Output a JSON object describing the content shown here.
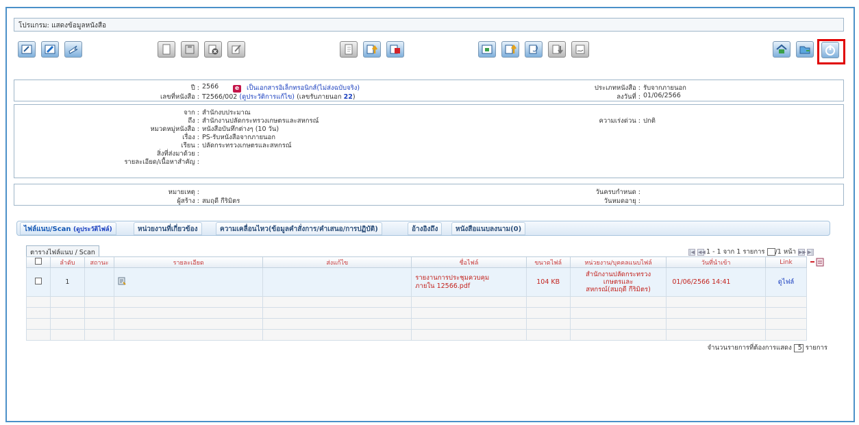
{
  "program_title": "โปรแกรม: แสดงข้อมูลหนังสือ",
  "toolbar": {
    "groups": [
      [
        "edit-icon",
        "pencil-icon",
        "forward-icon"
      ],
      [
        "document-icon",
        "save-icon",
        "delete-icon",
        "copy-icon"
      ],
      [
        "new-file-icon",
        "upload-icon",
        "red-stop-icon"
      ],
      [
        "download-icon",
        "import-icon",
        "attach-icon",
        "arrow-down-icon",
        "sign-icon"
      ],
      [
        "home-icon",
        "folder-icon",
        "power-icon"
      ]
    ]
  },
  "header_box": {
    "year_label": "ปี :",
    "year_value": "2566",
    "e_badge": "e",
    "electronic_text": "เป็นเอกสารอิเล็กทรอนิกส์(ไม่ส่งฉบับจริง)",
    "doc_no_label": "เลขที่หนังสือ :",
    "doc_no_value": "T2566/002",
    "history_link": "(ดูประวัติการแก้ไข)",
    "ext_no_text": "(เลขรับภายนอก",
    "ext_no_value": "22",
    "ext_no_close": ")",
    "type_label": "ประเภทหนังสือ :",
    "type_value": "รับจากภายนอก",
    "date_label": "ลงวันที่ :",
    "date_value": "01/06/2566"
  },
  "detail_box": {
    "rows": [
      {
        "label": "จาก :",
        "value": "สำนักงบประมาณ"
      },
      {
        "label": "ถึง :",
        "value": "สำนักงานปลัดกระทรวงเกษตรและสหกรณ์"
      },
      {
        "label": "หมวดหมู่หนังสือ :",
        "value": "หนังสือบันทึกต่างๆ (10 วัน)"
      },
      {
        "label": "เรื่อง :",
        "value": "PS-รับหนังสือจากภายนอก"
      },
      {
        "label": "เรียน :",
        "value": "ปลัดกระทรวงเกษตรและสหกรณ์"
      },
      {
        "label": "สิ่งที่ส่งมาด้วย :",
        "value": ""
      },
      {
        "label": "รายละเอียด/เนื้อหาสำคัญ :",
        "value": ""
      }
    ],
    "urgency_label": "ความเร่งด่วน :",
    "urgency_value": "ปกติ"
  },
  "note_box": {
    "note_label": "หมายเหตุ :",
    "note_value": "",
    "creator_label": "ผู้สร้าง :",
    "creator_value": "สมฤดี กีริมิตร",
    "due_label": "วันครบกำหนด :",
    "due_value": "",
    "expire_label": "วันหมดอายุ :",
    "expire_value": ""
  },
  "tabs": [
    {
      "label": "ไฟล์แนบ/Scan",
      "sub": "(ดูประวัติไฟล์)"
    },
    {
      "label": "หน่วยงานที่เกี่ยวข้อง"
    },
    {
      "label": "ความเคลื่อนไหว(ข้อมูลคำสั่งการ/คำเสนอ/การปฏิบัติ)"
    },
    {
      "label": "อ้างอิงถึง"
    },
    {
      "label": "หนังสือแนบลงนาม(0)"
    }
  ],
  "grid": {
    "caption": "ตารางไฟล์แนบ / Scan",
    "pager_text": "1 - 1 จาก 1 รายการ",
    "pager_page_suffix": "/1 หน้า",
    "columns": [
      "ลำดับ",
      "สถานะ",
      "รายละเอียด",
      "ส่งแก้ไข",
      "ชื่อไฟล์",
      "ขนาดไฟล์",
      "หน่วยงาน/บุคคลแนบไฟล์",
      "วันที่นำเข้า",
      "Link"
    ],
    "rows": [
      {
        "no": "1",
        "status": "",
        "detail_icon": "note-icon",
        "revise": "",
        "file_name_1": "รายงานการประชุมควบคุม",
        "file_name_2": "ภายใน 12566.pdf",
        "size": "104 KB",
        "attacher_1": "สำนักงานปลัดกระทรวง",
        "attacher_2": "เกษตรและ",
        "attacher_3": "สหกรณ์(สมฤดี กีริมิตร)",
        "date": "01/06/2566 14:41",
        "link": "ดูไฟล์"
      }
    ],
    "footer_prefix": "จำนวนรายการที่ต้องการแสดง",
    "footer_value": "5",
    "footer_suffix": "รายการ"
  },
  "colors": {
    "accent_red": "#e00000",
    "frame_blue": "#4a90c8",
    "link_blue": "#1a3fbf",
    "file_red": "#c3221d"
  }
}
